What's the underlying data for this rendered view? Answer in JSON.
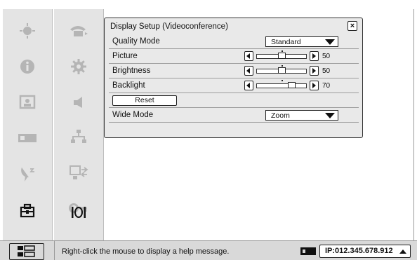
{
  "dialog": {
    "title": "Display Setup (Videoconference)",
    "close_symbol": "×",
    "rows": {
      "quality_mode": {
        "label": "Quality Mode",
        "value": "Standard"
      },
      "picture": {
        "label": "Picture",
        "value": "50",
        "level": 0.5
      },
      "brightness": {
        "label": "Brightness",
        "value": "50",
        "level": 0.5
      },
      "backlight": {
        "label": "Backlight",
        "value": "70",
        "level": 0.7
      },
      "reset": {
        "label": "Reset"
      },
      "wide_mode": {
        "label": "Wide Mode",
        "value": "Zoom"
      }
    }
  },
  "sidebar_outer": {
    "icons": [
      "camera-control-icon",
      "info-icon",
      "screen-icon",
      "camera-icon",
      "satellite-icon",
      "toolbox-icon"
    ]
  },
  "sidebar_inner": {
    "icons": [
      "phone-icon",
      "gear-icon",
      "speaker-icon",
      "network-icon",
      "display-output-icon",
      "key-icon",
      "display-setup-icon"
    ]
  },
  "status_bar": {
    "help_text": "Right-click the mouse to display a help message.",
    "ip": "IP:012.345.678.912",
    "icons": [
      "menu-toggle-icon",
      "camera-status-icon",
      "ip-dropdown-icon"
    ]
  },
  "colors": {
    "panel": "#e4e4e4",
    "dialog": "#e9e9e9",
    "status": "#d9d9d9",
    "icon_gray": "#b5b5b5",
    "icon_dark": "#111111"
  }
}
